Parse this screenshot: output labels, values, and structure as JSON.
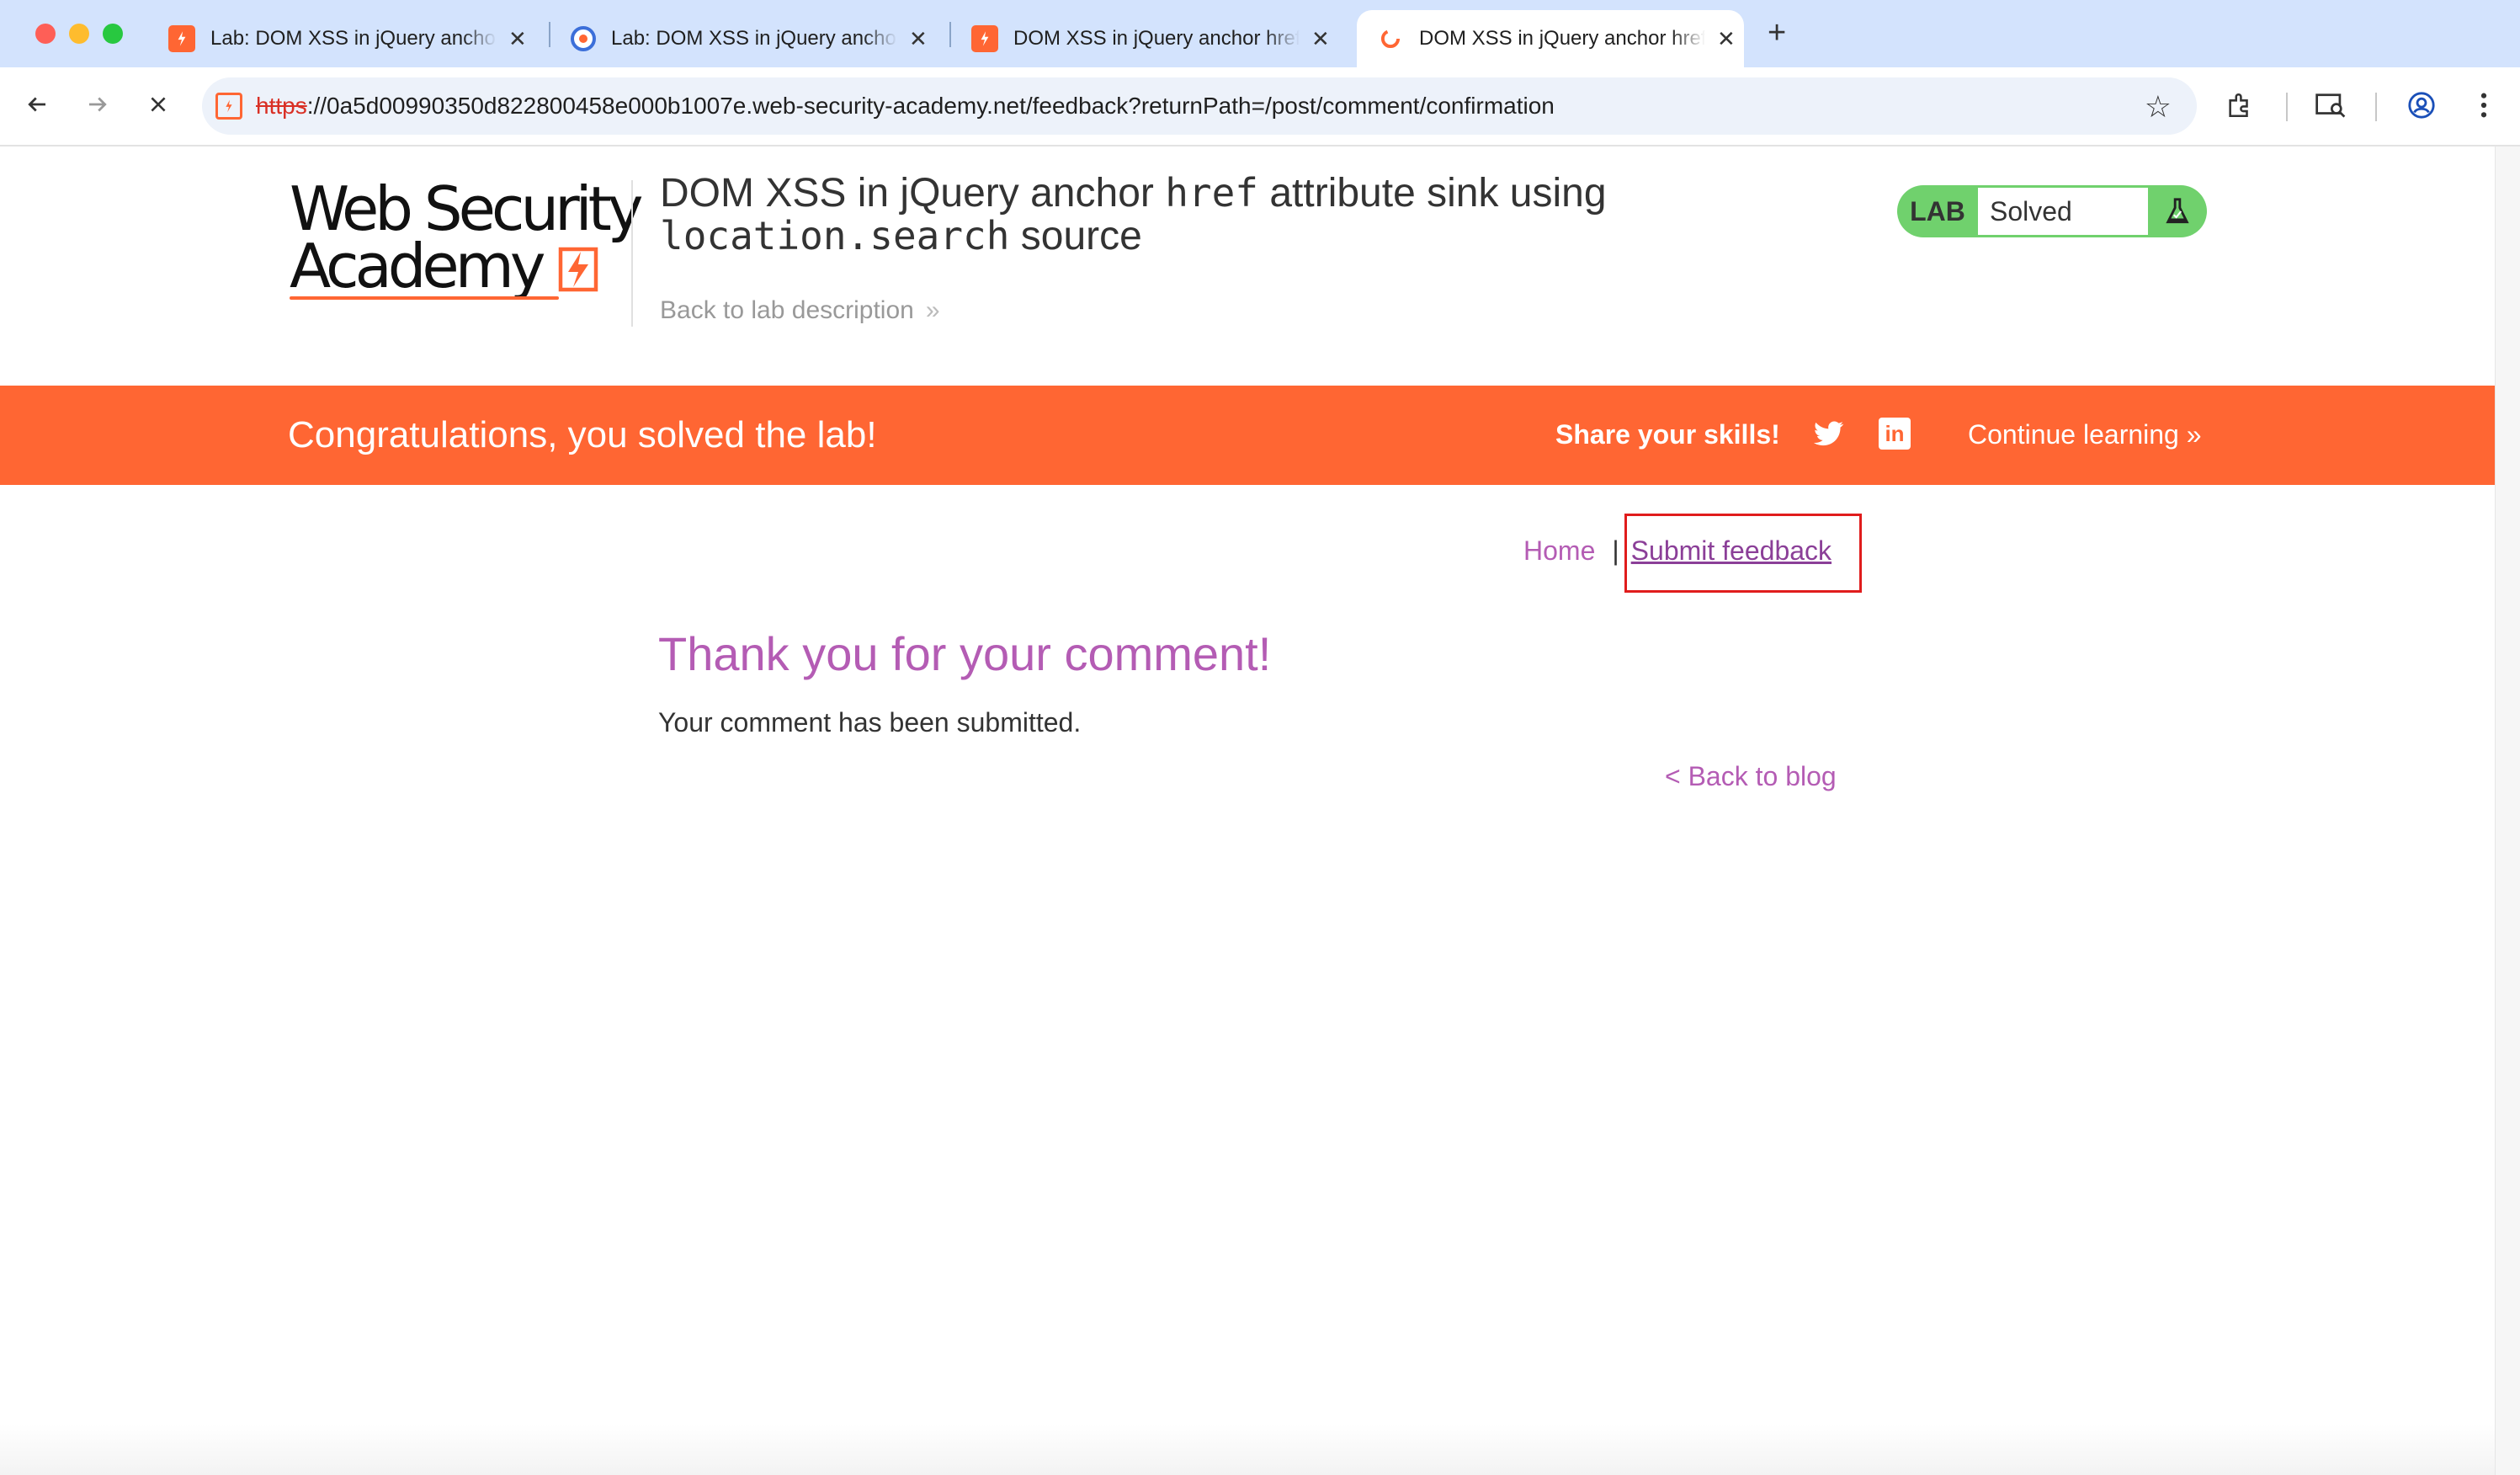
{
  "browser": {
    "tabs": [
      {
        "title": "Lab: DOM XSS in jQuery anchor href attribute sink using location.search source",
        "icon": "portswigger-icon",
        "active": false
      },
      {
        "title": "Lab: DOM XSS in jQuery anchor href attribute sink using location.search source",
        "icon": "chrome-icon",
        "active": false
      },
      {
        "title": "DOM XSS in jQuery anchor href attribute sink using location.search source",
        "icon": "portswigger-icon",
        "active": false
      },
      {
        "title": "DOM XSS in jQuery anchor href attribute sink using location.search source",
        "icon": "loading-icon",
        "active": true
      }
    ],
    "close_glyph": "✕",
    "new_tab_glyph": "+",
    "url_scheme": "https",
    "url_rest": "://0a5d00990350d822800458e000b1007e.web-security-academy.net/feedback?returnPath=/post/comment/confirmation"
  },
  "header": {
    "logo_line1": "Web Security",
    "logo_line2": "Academy",
    "title_part1": "DOM XSS in jQuery anchor ",
    "title_code1": "href",
    "title_part2": " attribute sink using",
    "title_code2": "location.search",
    "title_part3": " source",
    "back_link": "Back to lab description",
    "back_chevron": "»",
    "badge_label": "LAB",
    "badge_status": "Solved"
  },
  "banner": {
    "congrats": "Congratulations, you solved the lab!",
    "share": "Share your skills!",
    "linkedin_glyph": "in",
    "continue": "Continue learning »"
  },
  "nav": {
    "home": "Home",
    "separator": "|",
    "submit_feedback": "Submit feedback"
  },
  "content": {
    "heading": "Thank you for your comment!",
    "message": "Your comment has been submitted.",
    "back_to_blog": "< Back to blog"
  },
  "colors": {
    "brand_orange": "#ff6633",
    "link_purple": "#b45cb4",
    "lab_green": "#70d16d",
    "highlight_red": "#e01c1c"
  }
}
